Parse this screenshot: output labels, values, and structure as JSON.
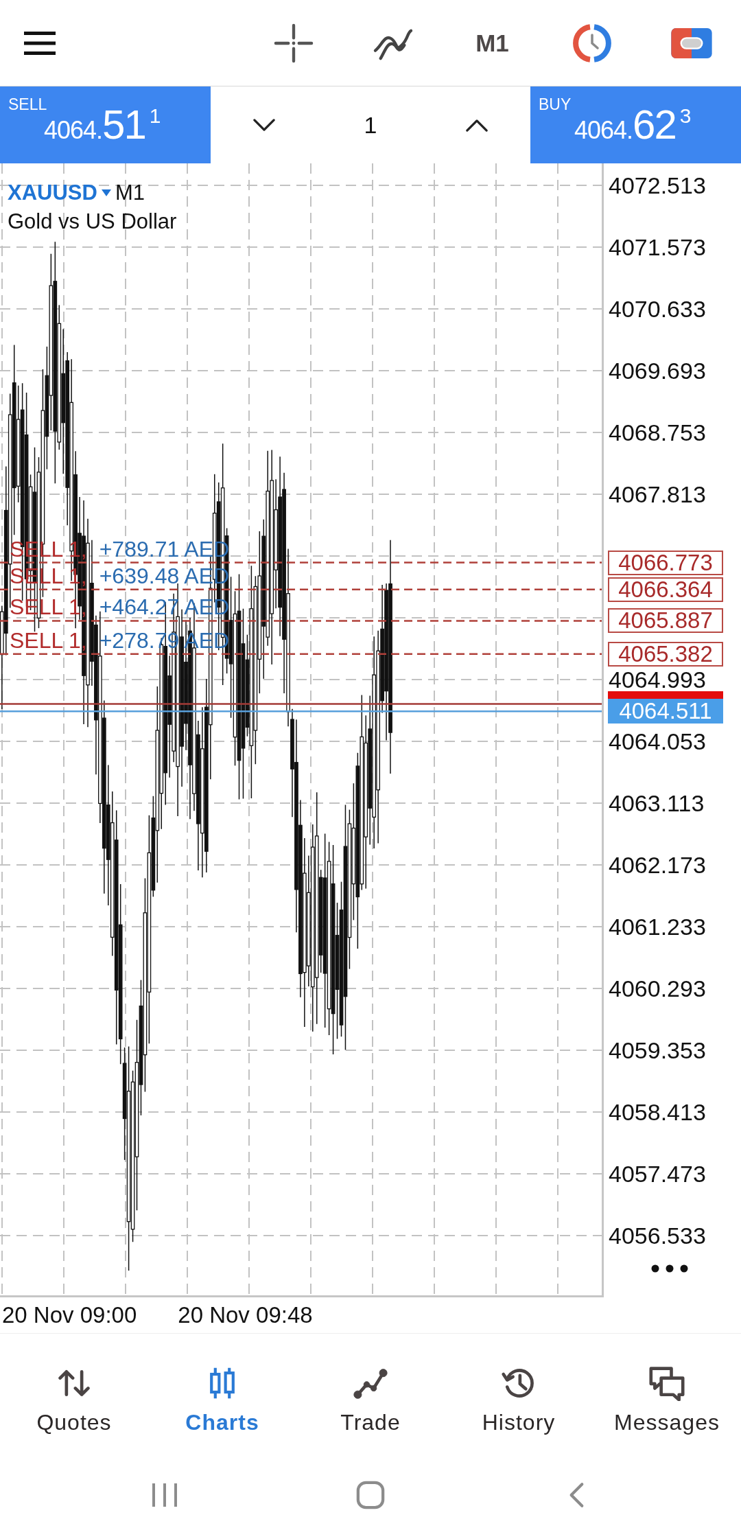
{
  "toolbar": {
    "timeframe": "M1"
  },
  "trade_bar": {
    "sell": {
      "label": "SELL",
      "price_prefix": "4064.",
      "price_pips": "51",
      "price_point": "1"
    },
    "volume": "1",
    "buy": {
      "label": "BUY",
      "price_prefix": "4064.",
      "price_pips": "62",
      "price_point": "3"
    }
  },
  "chart": {
    "symbol": "XAUUSD",
    "timeframe": "M1",
    "description": "Gold vs US Dollar",
    "price_axis": [
      "4072.513",
      "4071.573",
      "4070.633",
      "4069.693",
      "4068.753",
      "4067.813",
      "4064.993",
      "4064.053",
      "4063.113",
      "4062.173",
      "4061.233",
      "4060.293",
      "4059.353",
      "4058.413",
      "4057.473",
      "4056.533"
    ],
    "orders": [
      {
        "side": "SELL 1,",
        "profit": "+789.71 AED",
        "price": "4066.773"
      },
      {
        "side": "SELL 1,",
        "profit": "+639.48 AED",
        "price": "4066.364"
      },
      {
        "side": "SELL 1,",
        "profit": "+464.27 AED",
        "price": "4065.887"
      },
      {
        "side": "SELL 1,",
        "profit": "+278.79 AED",
        "price": "4065.382"
      }
    ],
    "bid_price": "4064.511",
    "time_axis": [
      "20 Nov 09:00",
      "20 Nov 09:48"
    ]
  },
  "bottom_nav": [
    {
      "label": "Quotes",
      "selected": false
    },
    {
      "label": "Charts",
      "selected": true
    },
    {
      "label": "Trade",
      "selected": false
    },
    {
      "label": "History",
      "selected": false
    },
    {
      "label": "Messages",
      "selected": false
    }
  ]
}
